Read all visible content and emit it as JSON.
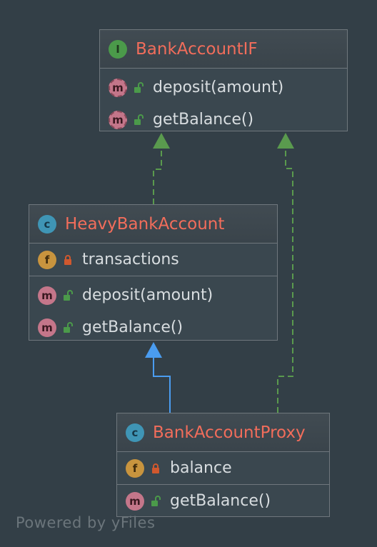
{
  "diagram": {
    "interface": {
      "kind_letter": "I",
      "name": "BankAccountIF",
      "methods": [
        {
          "badge": "m",
          "label": "deposit(amount)"
        },
        {
          "badge": "m",
          "label": "getBalance()"
        }
      ]
    },
    "heavy": {
      "kind_letter": "c",
      "name": "HeavyBankAccount",
      "fields": [
        {
          "badge": "f",
          "label": "transactions"
        }
      ],
      "methods": [
        {
          "badge": "m",
          "label": "deposit(amount)"
        },
        {
          "badge": "m",
          "label": "getBalance()"
        }
      ]
    },
    "proxy": {
      "kind_letter": "c",
      "name": "BankAccountProxy",
      "fields": [
        {
          "badge": "f",
          "label": "balance"
        }
      ],
      "methods": [
        {
          "badge": "m",
          "label": "getBalance()"
        }
      ]
    },
    "colors": {
      "background": "#333f47",
      "title": "#f26d5b",
      "implements_edge": "#5a9a4e",
      "extends_edge": "#4a9cf0"
    }
  },
  "watermark": "Powered by yFiles"
}
